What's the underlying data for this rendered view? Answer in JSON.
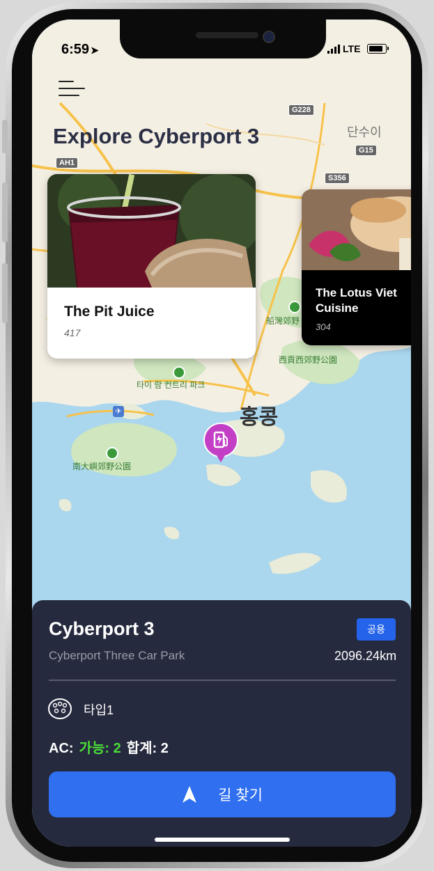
{
  "status_bar": {
    "time": "6:59",
    "network": "LTE"
  },
  "title": "Explore Cyberport 3",
  "map": {
    "labels": {
      "danshui": "단수이",
      "boat_park": "船灣郊野",
      "west_park": "西貢西郊野公園",
      "tai_lam": "타이 람 컨트리 파크",
      "hongkong": "홍콩",
      "south_lantau": "南大嶼郊野公園"
    },
    "road_badges": {
      "ah1": "AH1",
      "g228": "G228",
      "g15": "G15",
      "s356": "S356"
    }
  },
  "restaurants": [
    {
      "name": "The Pit Juice",
      "value": "417"
    },
    {
      "name": "The Lotus Viet Cuisine",
      "value": "304"
    }
  ],
  "station": {
    "name": "Cyberport 3",
    "badge": "공용",
    "address": "Cyberport Three Car Park",
    "distance": "2096.24km",
    "plug_type": "타입1",
    "ac_label": "AC:",
    "available_text": "가능: 2",
    "total_text": "합계: 2"
  },
  "actions": {
    "navigate": "길 찾기"
  },
  "colors": {
    "sheet_bg": "#262a3e",
    "primary": "#2f6ff0",
    "available": "#4ade3a",
    "pin": "#c23fc6"
  },
  "icons": {
    "menu": "menu-icon",
    "plug": "ev-plug-icon",
    "navigate": "navigation-arrow-icon",
    "pin": "ev-charger-pin-icon"
  }
}
